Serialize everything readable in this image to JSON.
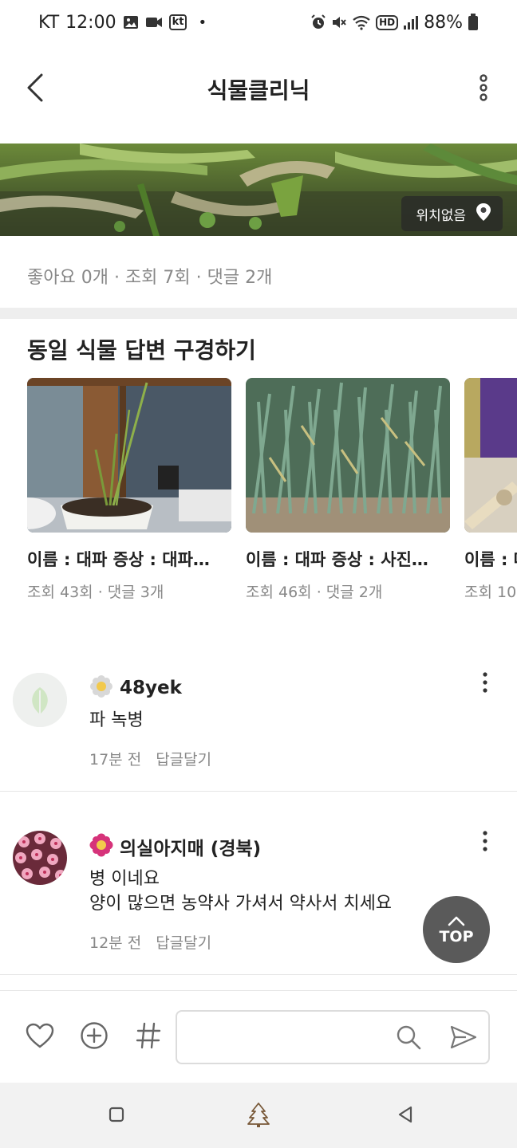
{
  "status_bar": {
    "carrier": "KT",
    "time": "12:00",
    "carrier_badge": "kt",
    "dot": "•",
    "hd_badge": "HD",
    "battery": "88%"
  },
  "header": {
    "title": "식물클리닉"
  },
  "hero": {
    "location": "위치없음"
  },
  "stats": "좋아요 0개 · 조회 7회 · 댓글 2개",
  "section": {
    "title": "동일 식물 답변 구경하기",
    "cards": [
      {
        "title": "이름 : 대파 증상 : 대파…",
        "meta": "조회 43회 · 댓글 3개"
      },
      {
        "title": "이름 : 대파 증상 : 사진…",
        "meta": "조회 46회 · 댓글 2개"
      },
      {
        "title": "이름 : 대",
        "meta": "조회 10"
      }
    ]
  },
  "comments": [
    {
      "name": "48yek",
      "text": "파 녹병",
      "time": "17분 전",
      "reply": "답글달기"
    },
    {
      "name": "의실아지매 (경북)",
      "text_line1": "병 이네요",
      "text_line2": "양이 많으면 농약사 가셔서 약사서 치세요",
      "time": "12분 전",
      "reply": "답글달기"
    }
  ],
  "top_button": {
    "label": "TOP"
  },
  "colors": {
    "accent_gray": "#5a5a5a",
    "meta_gray": "#888888",
    "divider": "#eeeeee"
  },
  "icons": {
    "back": "chevron-left-icon",
    "more": "more-vertical-icon",
    "location": "map-pin-icon",
    "like": "heart-icon",
    "add": "plus-circle-icon",
    "hashtag": "hashtag-icon",
    "search": "search-icon",
    "send": "send-icon",
    "nav_recent": "square-icon",
    "nav_home": "tree-icon",
    "nav_back": "triangle-back-icon"
  }
}
